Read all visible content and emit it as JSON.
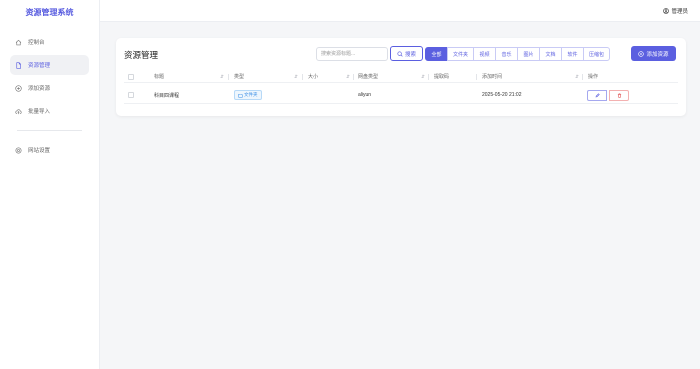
{
  "app": {
    "title": "资源管理系统"
  },
  "sidebar": {
    "items": [
      {
        "label": "控制台",
        "icon": "home-icon",
        "active": false
      },
      {
        "label": "资源管理",
        "icon": "file-icon",
        "active": true
      },
      {
        "label": "添加资源",
        "icon": "plus-circle-icon",
        "active": false
      },
      {
        "label": "批量导入",
        "icon": "cloud-upload-icon",
        "active": false
      }
    ],
    "settings": {
      "label": "网站设置",
      "icon": "settings-icon"
    }
  },
  "topbar": {
    "user": "管理员",
    "user_icon": "user-icon"
  },
  "main": {
    "title": "资源管理",
    "search": {
      "placeholder": "搜索资源标题...",
      "button_label": "搜索"
    },
    "filters": [
      "全部",
      "文件夹",
      "视频",
      "音乐",
      "图片",
      "文档",
      "软件",
      "压缩包"
    ],
    "active_filter": "全部",
    "add_button_label": "添加资源",
    "table": {
      "headers": [
        "标题",
        "类型",
        "大小",
        "网盘类型",
        "提取码",
        "添加时间",
        "操作"
      ],
      "rows": [
        {
          "title": "科目四课程",
          "type": "文件夹",
          "size": "",
          "pan_type": "aliyun",
          "code": "",
          "added": "2025-05-20 21:02"
        }
      ]
    }
  },
  "colors": {
    "accent": "#5b5fe0",
    "danger": "#e05a5a",
    "tag": "#3a8ee6"
  }
}
